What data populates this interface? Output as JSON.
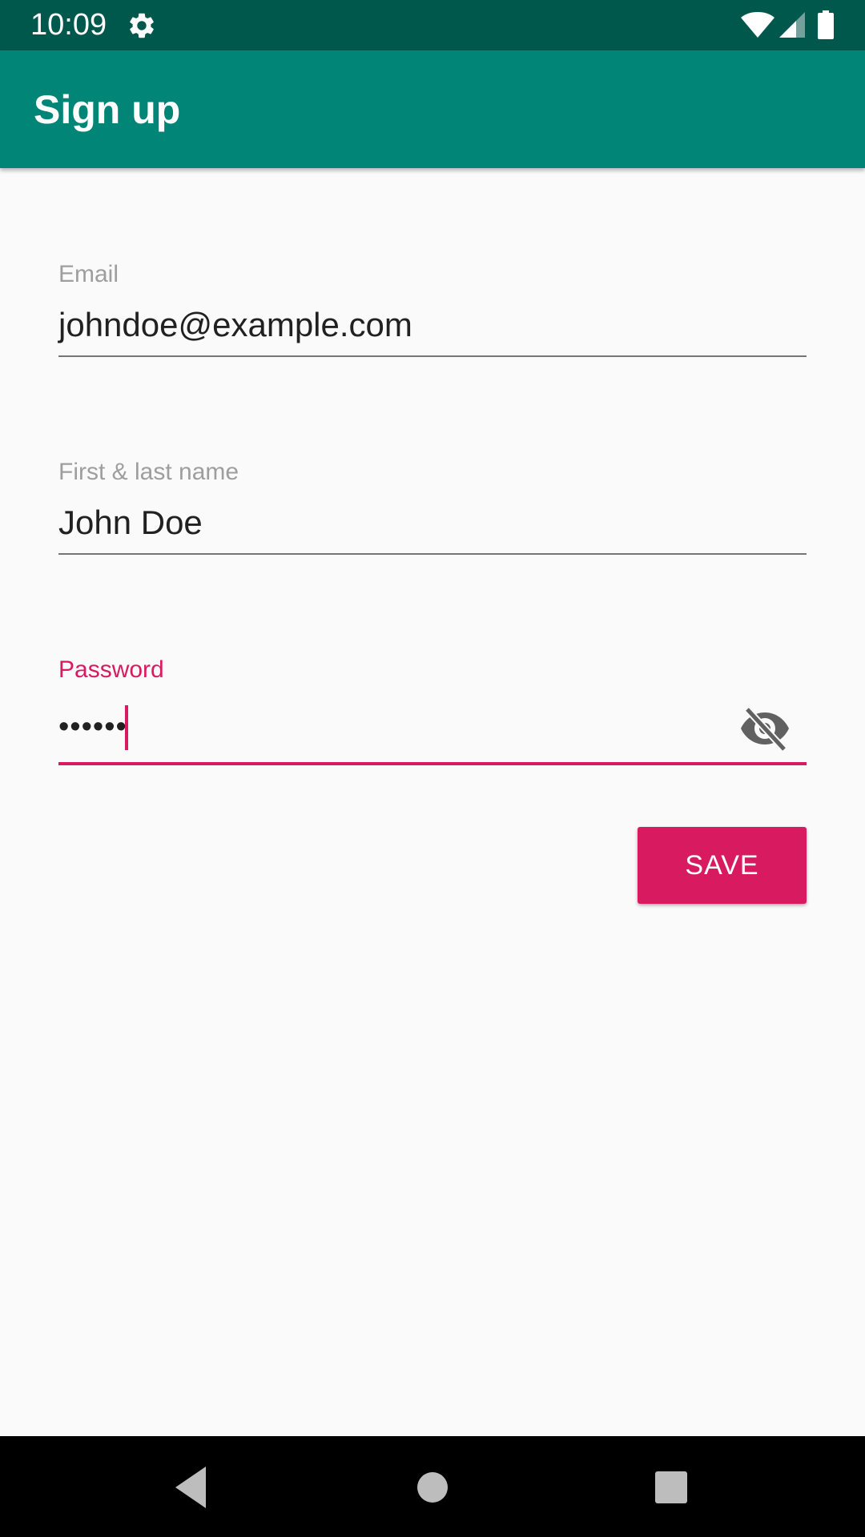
{
  "status_bar": {
    "time": "10:09",
    "icons": [
      "gear-icon",
      "wifi-icon",
      "signal-icon",
      "battery-icon"
    ],
    "background": "#00574b"
  },
  "app_bar": {
    "title": "Sign up",
    "background": "#008577"
  },
  "form": {
    "email": {
      "label": "Email",
      "value": "johndoe@example.com"
    },
    "name": {
      "label": "First & last name",
      "value": "John Doe"
    },
    "password": {
      "label": "Password",
      "value": "••••••",
      "focused": true,
      "toggle_icon": "visibility-off-icon"
    },
    "save_label": "SAVE"
  },
  "colors": {
    "accent": "#d81b60",
    "primary": "#008577",
    "primary_dark": "#00574b"
  },
  "nav_bar": {
    "icons": [
      "back-icon",
      "home-icon",
      "recents-icon"
    ]
  }
}
